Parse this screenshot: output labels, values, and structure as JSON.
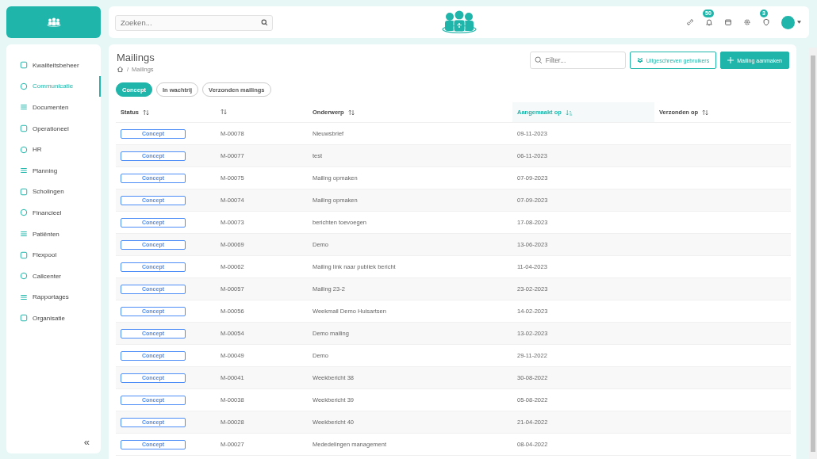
{
  "header": {
    "search": {
      "placeholder": "Zoeken..."
    },
    "notifications_badge": "50",
    "tasks_badge": "3"
  },
  "sidebar": {
    "items": [
      {
        "label": "Kwaliteitsbeheer",
        "selected": false
      },
      {
        "label": "Communicatie",
        "selected": true
      },
      {
        "label": "Documenten",
        "selected": false
      },
      {
        "label": "Operationeel",
        "selected": false
      },
      {
        "label": "HR",
        "selected": false
      },
      {
        "label": "Planning",
        "selected": false
      },
      {
        "label": "Scholingen",
        "selected": false
      },
      {
        "label": "Financieel",
        "selected": false
      },
      {
        "label": "Patiënten",
        "selected": false
      },
      {
        "label": "Flexpool",
        "selected": false
      },
      {
        "label": "Callcenter",
        "selected": false
      },
      {
        "label": "Rapportages",
        "selected": false
      },
      {
        "label": "Organisatie",
        "selected": false
      }
    ],
    "collapse": "«"
  },
  "page": {
    "title": "Mailings",
    "breadcrumb_separator": "/",
    "breadcrumb": "Mailings",
    "filter": {
      "placeholder": "Filter..."
    },
    "buttons": [
      "Uitgeschreven gebruikers",
      "Mailing aanmaken"
    ]
  },
  "tabs": [
    {
      "label": "Concept",
      "selected": true
    },
    {
      "label": "In wachtrij",
      "selected": false
    },
    {
      "label": "Verzonden mailings",
      "selected": false
    }
  ],
  "table": {
    "columns": [
      {
        "label": "Status",
        "sorted": false
      },
      {
        "sorted": false
      },
      {
        "label": "Onderwerp",
        "sorted": false
      },
      {
        "label": "Aangemaakt op",
        "sorted": true
      },
      {
        "label": "Verzonden op",
        "sorted": false
      }
    ],
    "rows": [
      [
        "Concept",
        "M-00078",
        "Nieuwsbrief",
        "09-11-2023"
      ],
      [
        "Concept",
        "M-00077",
        "test",
        "06-11-2023"
      ],
      [
        "Concept",
        "M-00075",
        "Mailing opmaken",
        "07-09-2023"
      ],
      [
        "Concept",
        "M-00074",
        "Mailing opmaken",
        "07-09-2023"
      ],
      [
        "Concept",
        "M-00073",
        "berichten toevoegen",
        "17-08-2023"
      ],
      [
        "Concept",
        "M-00069",
        "Demo",
        "13-06-2023"
      ],
      [
        "Concept",
        "M-00062",
        "Mailing link naar publiek bericht",
        "11-04-2023"
      ],
      [
        "Concept",
        "M-00057",
        "Mailing 23-2",
        "23-02-2023"
      ],
      [
        "Concept",
        "M-00056",
        "Weekmail Demo Huisartsen",
        "14-02-2023"
      ],
      [
        "Concept",
        "M-00054",
        "Demo mailing",
        "13-02-2023"
      ],
      [
        "Concept",
        "M-00049",
        "Demo",
        "29-11-2022"
      ],
      [
        "Concept",
        "M-00041",
        "Weekbericht 38",
        "30-08-2022"
      ],
      [
        "Concept",
        "M-00038",
        "Weekbericht 39",
        "05-08-2022"
      ],
      [
        "Concept",
        "M-00028",
        "Weekbericht 40",
        "21-04-2022"
      ],
      [
        "Concept",
        "M-00027",
        "Mededelingen management",
        "08-04-2022"
      ]
    ]
  }
}
